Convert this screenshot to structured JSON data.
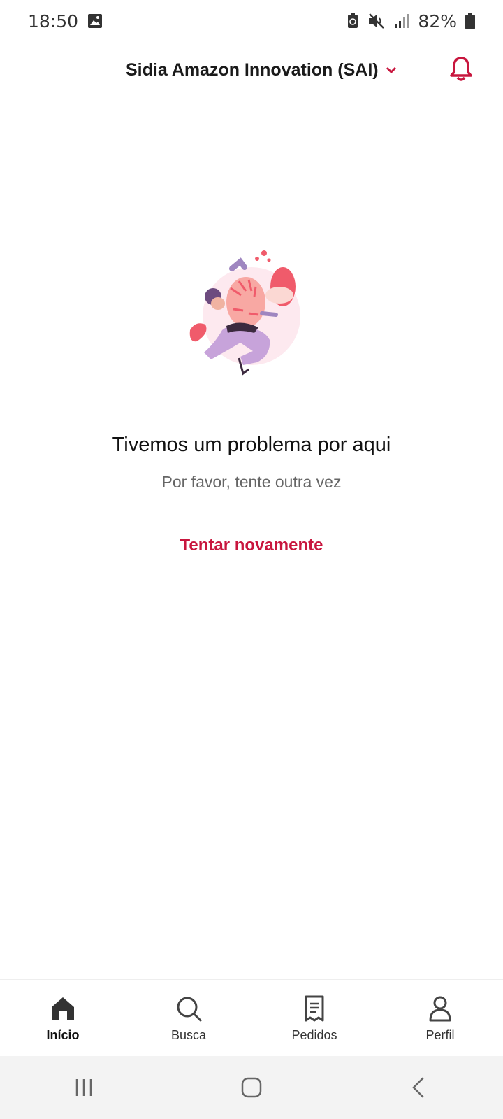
{
  "status_bar": {
    "time": "18:50",
    "battery": "82%",
    "icons": [
      "image-icon",
      "battery-saver-icon",
      "mute-icon",
      "signal-icon",
      "battery-icon"
    ]
  },
  "header": {
    "address": "Sidia Amazon Innovation (SAI)",
    "accent_color": "#c8163e"
  },
  "error": {
    "title": "Tivemos um problema por aqui",
    "subtitle": "Por favor, tente outra vez",
    "retry_label": "Tentar novamente"
  },
  "bottom_nav": {
    "items": [
      {
        "label": "Início",
        "icon": "home-icon",
        "active": true
      },
      {
        "label": "Busca",
        "icon": "search-icon",
        "active": false
      },
      {
        "label": "Pedidos",
        "icon": "orders-icon",
        "active": false
      },
      {
        "label": "Perfil",
        "icon": "profile-icon",
        "active": false
      }
    ]
  },
  "system_nav": {
    "icons": [
      "recent-apps-icon",
      "home-button-icon",
      "back-icon"
    ]
  }
}
